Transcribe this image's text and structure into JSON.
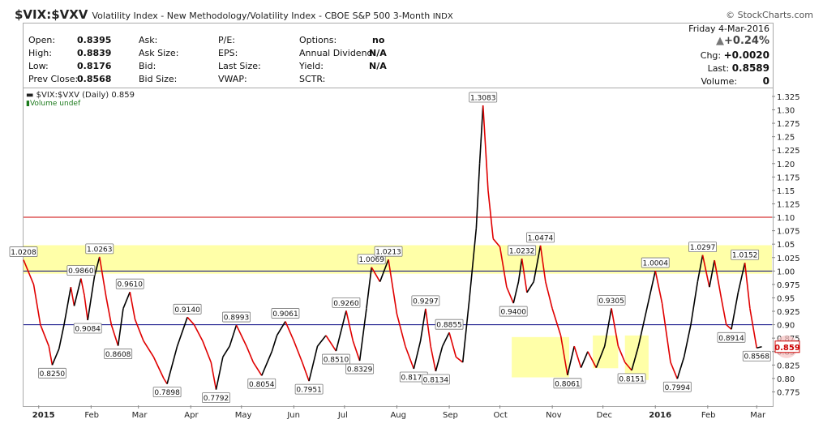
{
  "header": {
    "symbol": "$VIX:$VXV",
    "description": "Volatility Index - New Methodology/Volatility Index - CBOE S&P 500 3-Month",
    "exchange": "INDX",
    "brand": "© StockCharts.com"
  },
  "stats": {
    "left": [
      {
        "label": "Open:",
        "value": "0.8395"
      },
      {
        "label": "High:",
        "value": "0.8839"
      },
      {
        "label": "Low:",
        "value": "0.8176"
      },
      {
        "label": "Prev Close:",
        "value": "0.8568"
      }
    ],
    "col2": [
      "Ask:",
      "Ask Size:",
      "Bid:",
      "Bid Size:"
    ],
    "col3": [
      "P/E:",
      "EPS:",
      "Last Size:",
      "VWAP:"
    ],
    "col4": [
      {
        "label": "Options:",
        "value": "no"
      },
      {
        "label": "Annual Dividend:",
        "value": "N/A"
      },
      {
        "label": "Yield:",
        "value": "N/A"
      },
      {
        "label": "SCTR:",
        "value": ""
      }
    ],
    "right": {
      "date": "Friday  4-Mar-2016",
      "pct_change": "+0.24%",
      "chg_label": "Chg:",
      "chg_value": "+0.0020",
      "last_label": "Last:",
      "last_value": "0.8589",
      "volume_label": "Volume:",
      "volume_value": "0"
    }
  },
  "legend": {
    "series": "$VIX:$VXV (Daily) 0.859",
    "volume": "Volume undef"
  },
  "colors": {
    "up": "#000000",
    "down": "#e00000",
    "highlight": "#ffff99",
    "red_line": "#cc0000",
    "blue_line": "#000080"
  },
  "chart_data": {
    "type": "line",
    "ylim": [
      0.75,
      1.34
    ],
    "yticks": [
      0.775,
      0.8,
      0.825,
      0.85,
      0.875,
      0.9,
      0.925,
      0.95,
      0.975,
      1.0,
      1.025,
      1.05,
      1.075,
      1.1,
      1.125,
      1.15,
      1.175,
      1.2,
      1.225,
      1.25,
      1.275,
      1.3,
      1.325
    ],
    "ytick_labels": [
      "0.775",
      "0.80",
      "0.825",
      "0.85",
      "0.875",
      "0.90",
      "0.925",
      "0.95",
      "0.975",
      "1.00",
      "1.025",
      "1.05",
      "1.075",
      "1.10",
      "1.125",
      "1.15",
      "1.175",
      "1.20",
      "1.225",
      "1.25",
      "1.275",
      "1.30",
      "1.325"
    ],
    "xticks": [
      {
        "label": "2015",
        "x": "2015-01-01",
        "bold": true
      },
      {
        "label": "Feb",
        "x": "2015-02-01"
      },
      {
        "label": "Mar",
        "x": "2015-03-01"
      },
      {
        "label": "Apr",
        "x": "2015-04-01"
      },
      {
        "label": "May",
        "x": "2015-05-01"
      },
      {
        "label": "Jun",
        "x": "2015-06-01"
      },
      {
        "label": "Jul",
        "x": "2015-07-01"
      },
      {
        "label": "Aug",
        "x": "2015-08-01"
      },
      {
        "label": "Sep",
        "x": "2015-09-01"
      },
      {
        "label": "Oct",
        "x": "2015-10-01"
      },
      {
        "label": "Nov",
        "x": "2015-11-01"
      },
      {
        "label": "Dec",
        "x": "2015-12-01"
      },
      {
        "label": "2016",
        "x": "2016-01-01",
        "bold": true
      },
      {
        "label": "Feb",
        "x": "2016-02-01"
      },
      {
        "label": "Mar",
        "x": "2016-03-01"
      }
    ],
    "x_range": [
      "2014-12-23",
      "2016-03-10"
    ],
    "hlines": [
      {
        "y": 1.1,
        "color": "#cc0000"
      },
      {
        "y": 1.0,
        "color": "#000080"
      },
      {
        "y": 0.9,
        "color": "#000080"
      }
    ],
    "highlight_band": [
      0.995,
      1.048
    ],
    "highlight_boxes": [
      {
        "x0": "2015-10-08",
        "x1": "2015-11-11",
        "y0": 0.802,
        "y1": 0.877
      },
      {
        "x0": "2015-11-25",
        "x1": "2015-12-10",
        "y0": 0.819,
        "y1": 0.88
      },
      {
        "x0": "2015-12-14",
        "x1": "2015-12-28",
        "y0": 0.797,
        "y1": 0.88
      }
    ],
    "series": [
      {
        "name": "$VIX:$VXV",
        "points": [
          [
            "2014-12-23",
            1.0208
          ],
          [
            "2014-12-29",
            0.975
          ],
          [
            "2015-01-02",
            0.9
          ],
          [
            "2015-01-07",
            0.86
          ],
          [
            "2015-01-09",
            0.825
          ],
          [
            "2015-01-13",
            0.855
          ],
          [
            "2015-01-16",
            0.9
          ],
          [
            "2015-01-20",
            0.97
          ],
          [
            "2015-01-22",
            0.935
          ],
          [
            "2015-01-26",
            0.986
          ],
          [
            "2015-01-28",
            0.955
          ],
          [
            "2015-01-30",
            0.9084
          ],
          [
            "2015-02-03",
            0.99
          ],
          [
            "2015-02-06",
            1.0263
          ],
          [
            "2015-02-10",
            0.95
          ],
          [
            "2015-02-13",
            0.9
          ],
          [
            "2015-02-17",
            0.8608
          ],
          [
            "2015-02-20",
            0.93
          ],
          [
            "2015-02-24",
            0.961
          ],
          [
            "2015-02-27",
            0.91
          ],
          [
            "2015-03-04",
            0.87
          ],
          [
            "2015-03-10",
            0.84
          ],
          [
            "2015-03-16",
            0.8
          ],
          [
            "2015-03-18",
            0.7898
          ],
          [
            "2015-03-24",
            0.86
          ],
          [
            "2015-03-30",
            0.914
          ],
          [
            "2015-04-03",
            0.9
          ],
          [
            "2015-04-08",
            0.87
          ],
          [
            "2015-04-13",
            0.83
          ],
          [
            "2015-04-16",
            0.7792
          ],
          [
            "2015-04-20",
            0.84
          ],
          [
            "2015-04-24",
            0.86
          ],
          [
            "2015-04-28",
            0.8993
          ],
          [
            "2015-05-04",
            0.86
          ],
          [
            "2015-05-08",
            0.83
          ],
          [
            "2015-05-13",
            0.8054
          ],
          [
            "2015-05-19",
            0.85
          ],
          [
            "2015-05-22",
            0.88
          ],
          [
            "2015-05-27",
            0.9061
          ],
          [
            "2015-06-01",
            0.87
          ],
          [
            "2015-06-06",
            0.83
          ],
          [
            "2015-06-10",
            0.7951
          ],
          [
            "2015-06-15",
            0.86
          ],
          [
            "2015-06-20",
            0.88
          ],
          [
            "2015-06-26",
            0.851
          ],
          [
            "2015-07-02",
            0.926
          ],
          [
            "2015-07-06",
            0.87
          ],
          [
            "2015-07-10",
            0.8329
          ],
          [
            "2015-07-14",
            0.93
          ],
          [
            "2015-07-17",
            1.0069
          ],
          [
            "2015-07-22",
            0.98
          ],
          [
            "2015-07-27",
            1.0213
          ],
          [
            "2015-08-01",
            0.92
          ],
          [
            "2015-08-06",
            0.86
          ],
          [
            "2015-08-11",
            0.8179
          ],
          [
            "2015-08-15",
            0.87
          ],
          [
            "2015-08-18",
            0.9297
          ],
          [
            "2015-08-21",
            0.86
          ],
          [
            "2015-08-24",
            0.8134
          ],
          [
            "2015-08-28",
            0.86
          ],
          [
            "2015-09-01",
            0.8855
          ],
          [
            "2015-09-05",
            0.84
          ],
          [
            "2015-09-09",
            0.83
          ],
          [
            "2015-09-13",
            0.95
          ],
          [
            "2015-09-17",
            1.08
          ],
          [
            "2015-09-19",
            1.2
          ],
          [
            "2015-09-21",
            1.3083
          ],
          [
            "2015-09-24",
            1.15
          ],
          [
            "2015-09-27",
            1.06
          ],
          [
            "2015-10-01",
            1.045
          ],
          [
            "2015-10-05",
            0.97
          ],
          [
            "2015-10-09",
            0.94
          ],
          [
            "2015-10-12",
            0.98
          ],
          [
            "2015-10-14",
            1.0232
          ],
          [
            "2015-10-17",
            0.96
          ],
          [
            "2015-10-21",
            0.98
          ],
          [
            "2015-10-25",
            1.0474
          ],
          [
            "2015-10-28",
            0.98
          ],
          [
            "2015-11-01",
            0.93
          ],
          [
            "2015-11-06",
            0.88
          ],
          [
            "2015-11-10",
            0.8061
          ],
          [
            "2015-11-14",
            0.86
          ],
          [
            "2015-11-18",
            0.82
          ],
          [
            "2015-11-22",
            0.85
          ],
          [
            "2015-11-27",
            0.82
          ],
          [
            "2015-12-02",
            0.86
          ],
          [
            "2015-12-06",
            0.9305
          ],
          [
            "2015-12-10",
            0.86
          ],
          [
            "2015-12-14",
            0.83
          ],
          [
            "2015-12-18",
            0.8151
          ],
          [
            "2015-12-22",
            0.86
          ],
          [
            "2016-01-01",
            1.0004
          ],
          [
            "2016-01-05",
            0.94
          ],
          [
            "2016-01-10",
            0.83
          ],
          [
            "2016-01-14",
            0.7994
          ],
          [
            "2016-01-18",
            0.84
          ],
          [
            "2016-01-22",
            0.9
          ],
          [
            "2016-01-26",
            0.98
          ],
          [
            "2016-01-29",
            1.0297
          ],
          [
            "2016-02-02",
            0.97
          ],
          [
            "2016-02-05",
            1.02
          ],
          [
            "2016-02-09",
            0.95
          ],
          [
            "2016-02-12",
            0.9
          ],
          [
            "2016-02-15",
            0.8914
          ],
          [
            "2016-02-19",
            0.96
          ],
          [
            "2016-02-23",
            1.0152
          ],
          [
            "2016-02-26",
            0.93
          ],
          [
            "2016-03-01",
            0.8568
          ],
          [
            "2016-03-04",
            0.859
          ]
        ]
      }
    ],
    "labels": [
      {
        "x": "2014-12-23",
        "y": 1.0208,
        "text": "1.0208",
        "pos": "above"
      },
      {
        "x": "2015-01-09",
        "y": 0.825,
        "text": "0.8250",
        "pos": "below"
      },
      {
        "x": "2015-01-26",
        "y": 0.986,
        "text": "0.9860",
        "pos": "above"
      },
      {
        "x": "2015-01-30",
        "y": 0.9084,
        "text": "0.9084",
        "pos": "below"
      },
      {
        "x": "2015-02-06",
        "y": 1.0263,
        "text": "1.0263",
        "pos": "above"
      },
      {
        "x": "2015-02-17",
        "y": 0.8608,
        "text": "0.8608",
        "pos": "below"
      },
      {
        "x": "2015-02-24",
        "y": 0.961,
        "text": "0.9610",
        "pos": "above"
      },
      {
        "x": "2015-03-18",
        "y": 0.7898,
        "text": "0.7898",
        "pos": "below"
      },
      {
        "x": "2015-03-30",
        "y": 0.914,
        "text": "0.9140",
        "pos": "above"
      },
      {
        "x": "2015-04-16",
        "y": 0.7792,
        "text": "0.7792",
        "pos": "below"
      },
      {
        "x": "2015-04-28",
        "y": 0.8993,
        "text": "0.8993",
        "pos": "above"
      },
      {
        "x": "2015-05-13",
        "y": 0.8054,
        "text": "0.8054",
        "pos": "below"
      },
      {
        "x": "2015-05-27",
        "y": 0.9061,
        "text": "0.9061",
        "pos": "above"
      },
      {
        "x": "2015-06-10",
        "y": 0.7951,
        "text": "0.7951",
        "pos": "below"
      },
      {
        "x": "2015-06-26",
        "y": 0.851,
        "text": "0.8510",
        "pos": "below"
      },
      {
        "x": "2015-07-02",
        "y": 0.926,
        "text": "0.9260",
        "pos": "above"
      },
      {
        "x": "2015-07-10",
        "y": 0.8329,
        "text": "0.8329",
        "pos": "below"
      },
      {
        "x": "2015-07-17",
        "y": 1.0069,
        "text": "1.0069",
        "pos": "above"
      },
      {
        "x": "2015-07-27",
        "y": 1.0213,
        "text": "1.0213",
        "pos": "above"
      },
      {
        "x": "2015-08-11",
        "y": 0.8179,
        "text": "0.8179",
        "pos": "below"
      },
      {
        "x": "2015-08-18",
        "y": 0.9297,
        "text": "0.9297",
        "pos": "above"
      },
      {
        "x": "2015-08-24",
        "y": 0.8134,
        "text": "0.8134",
        "pos": "below"
      },
      {
        "x": "2015-09-01",
        "y": 0.8855,
        "text": "0.8855",
        "pos": "above"
      },
      {
        "x": "2015-09-21",
        "y": 1.3083,
        "text": "1.3083",
        "pos": "above"
      },
      {
        "x": "2015-10-09",
        "y": 0.94,
        "text": "0.9400",
        "pos": "below"
      },
      {
        "x": "2015-10-14",
        "y": 1.0232,
        "text": "1.0232",
        "pos": "above"
      },
      {
        "x": "2015-10-25",
        "y": 1.0474,
        "text": "1.0474",
        "pos": "above"
      },
      {
        "x": "2015-11-10",
        "y": 0.8061,
        "text": "0.8061",
        "pos": "below"
      },
      {
        "x": "2015-12-06",
        "y": 0.9305,
        "text": "0.9305",
        "pos": "above"
      },
      {
        "x": "2015-12-18",
        "y": 0.8151,
        "text": "0.8151",
        "pos": "below"
      },
      {
        "x": "2016-01-01",
        "y": 1.0004,
        "text": "1.0004",
        "pos": "above"
      },
      {
        "x": "2016-01-14",
        "y": 0.7994,
        "text": "0.7994",
        "pos": "below"
      },
      {
        "x": "2016-01-29",
        "y": 1.0297,
        "text": "1.0297",
        "pos": "above"
      },
      {
        "x": "2016-02-15",
        "y": 0.8914,
        "text": "0.8914",
        "pos": "below"
      },
      {
        "x": "2016-02-23",
        "y": 1.0152,
        "text": "1.0152",
        "pos": "above"
      },
      {
        "x": "2016-03-01",
        "y": 0.8568,
        "text": "0.8568",
        "pos": "below"
      }
    ],
    "last_value": {
      "text": "0.859",
      "y": 0.859
    }
  }
}
